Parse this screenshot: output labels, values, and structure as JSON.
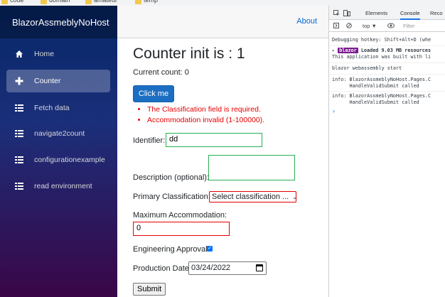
{
  "bookmarks": [
    {
      "label": "code"
    },
    {
      "label": "domain"
    },
    {
      "label": "amateur"
    },
    {
      "label": "temp"
    }
  ],
  "sidebar": {
    "brand": "BlazorAssmeblyNoHost",
    "items": [
      {
        "label": "Home",
        "icon": "home-icon"
      },
      {
        "label": "Counter",
        "icon": "plus-icon"
      },
      {
        "label": "Fetch data",
        "icon": "list-icon"
      },
      {
        "label": "navigate2count",
        "icon": "list-icon"
      },
      {
        "label": "configurationexample",
        "icon": "list-icon"
      },
      {
        "label": "read environment",
        "icon": "list-icon"
      }
    ]
  },
  "topbar": {
    "about": "About"
  },
  "page": {
    "title": "Counter init is : 1",
    "current_count": "Current count: 0",
    "click_me": "Click me",
    "errors": [
      "The Classification field is required.",
      "Accommodation invalid (1-100000)."
    ],
    "identifier_label": "Identifier:",
    "identifier_value": "dd",
    "description_label": "Description (optional):",
    "description_value": "",
    "classification_label": "Primary Classification:",
    "classification_value": "Select classification ...",
    "accommodation_label": "Maximum Accommodation:",
    "accommodation_value": "0",
    "approval_label": "Engineering Approval:",
    "approval_checked": true,
    "date_label": "Production Date:",
    "date_value": "03/24/2022",
    "submit": "Submit"
  },
  "devtools": {
    "tabs": [
      "Elements",
      "Console",
      "Reco"
    ],
    "active_tab": "Console",
    "context": "top ▼",
    "filter_placeholder": "Filter",
    "logs": [
      "Debugging hotkey: Shift+Alt+D (whe",
      "Loaded 9.03 MB resources",
      "This application was built with li",
      "blazor webassembly start",
      "info: BlazorAssmeblyNoHost.Pages.C",
      "      HandleValidSubmit called",
      "info: BlazorAssmeblyNoHost.Pages.C",
      "      HandleValidSubmit called"
    ],
    "badge": "blazor",
    "prompt": "›"
  },
  "colors": {
    "accent": "#1b6ec2",
    "error": "#e50000",
    "valid": "#26b050",
    "link": "#0366d6"
  }
}
